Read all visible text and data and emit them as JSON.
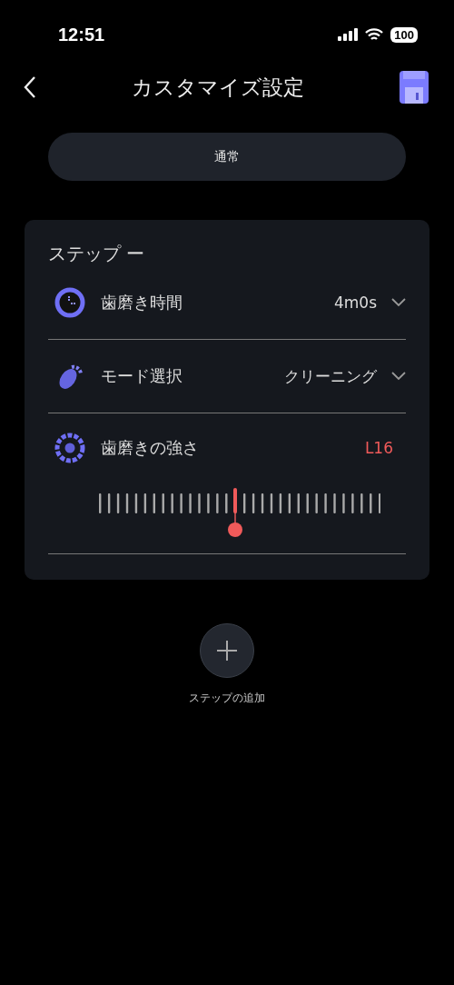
{
  "status_bar": {
    "time": "12:51",
    "battery": "100"
  },
  "header": {
    "title": "カスタマイズ設定"
  },
  "mode_button": {
    "label": "通常"
  },
  "step": {
    "title": "ステップ ー",
    "rows": [
      {
        "kind": "dropdown",
        "label": "歯磨き時間",
        "value": "4m0s"
      },
      {
        "kind": "dropdown",
        "label": "モード選択",
        "value": "クリーニング"
      },
      {
        "kind": "slider",
        "label": "歯磨きの強さ",
        "value": "L16",
        "level": 0.484
      }
    ]
  },
  "add_step": {
    "label": "ステップの追加"
  }
}
